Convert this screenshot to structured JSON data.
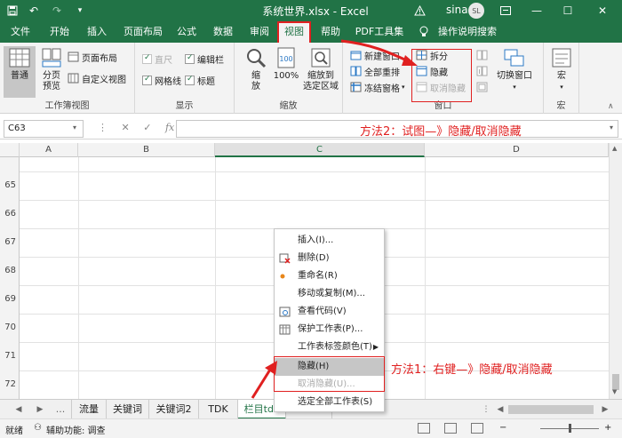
{
  "title_bar": {
    "quick_access": [
      "save-icon",
      "undo-icon",
      "redo-icon",
      "customize-icon"
    ],
    "title": "系统世界.xlsx  -  Excel",
    "user_name": "sina lin",
    "avatar_initials": "SL"
  },
  "menu_tabs": [
    {
      "label": "文件",
      "active": false
    },
    {
      "label": "开始",
      "active": false
    },
    {
      "label": "插入",
      "active": false
    },
    {
      "label": "页面布局",
      "active": false
    },
    {
      "label": "公式",
      "active": false
    },
    {
      "label": "数据",
      "active": false
    },
    {
      "label": "审阅",
      "active": false
    },
    {
      "label": "视图",
      "active": true
    },
    {
      "label": "帮助",
      "active": false
    },
    {
      "label": "PDF工具集",
      "active": false
    },
    {
      "label": "操作说明搜索",
      "active": false
    }
  ],
  "ribbon": {
    "workbook_views": {
      "label": "工作簿视图",
      "normal": "普通",
      "page_break": "分页\n预览",
      "page_layout": "页面布局",
      "custom_views": "自定义视图"
    },
    "show": {
      "label": "显示",
      "ruler": "直尺",
      "formula_bar": "编辑栏",
      "gridlines": "网格线",
      "headings": "标题"
    },
    "zoom": {
      "label": "缩放",
      "zoom": "缩\n放",
      "hundred": "100%",
      "zoom_selection": "缩放到\n选定区域"
    },
    "window": {
      "label": "窗口",
      "new_window": "新建窗口",
      "arrange_all": "全部重排",
      "freeze_panes": "冻结窗格",
      "split": "拆分",
      "hide": "隐藏",
      "unhide": "取消隐藏",
      "switch_windows": "切换窗口"
    },
    "macros": {
      "label": "宏",
      "macros": "宏"
    }
  },
  "formula_bar": {
    "name_box": "C63",
    "fx_label": "fx"
  },
  "annotations": {
    "method2": "方法2：试图—》隐藏/取消隐藏",
    "method1": "方法1：右键—》隐藏/取消隐藏"
  },
  "columns": [
    "A",
    "B",
    "C",
    "D"
  ],
  "rows": [
    "65",
    "66",
    "67",
    "68",
    "69",
    "70",
    "71",
    "72"
  ],
  "sheet_tabs": {
    "nav": [
      "◀",
      "▶",
      "..."
    ],
    "tabs": [
      "流量",
      "关键词",
      "关键词2",
      "TDK",
      "栏目tdk",
      "Sheet"
    ],
    "active_index": 4
  },
  "status_bar": {
    "ready": "就绪",
    "accessibility": "辅助功能: 调查",
    "zoom_percent": 100
  },
  "context_menu": [
    {
      "label": "插入(I)...",
      "icon": "",
      "disabled": false,
      "submenu": false,
      "highlighted": false
    },
    {
      "label": "删除(D)",
      "icon": "delete-sheet-icon",
      "disabled": false,
      "submenu": false,
      "highlighted": false
    },
    {
      "label": "重命名(R)",
      "icon": "rename-icon",
      "disabled": false,
      "submenu": false,
      "highlighted": false
    },
    {
      "label": "移动或复制(M)...",
      "icon": "",
      "disabled": false,
      "submenu": false,
      "highlighted": false
    },
    {
      "label": "查看代码(V)",
      "icon": "view-code-icon",
      "disabled": false,
      "submenu": false,
      "highlighted": false
    },
    {
      "label": "保护工作表(P)...",
      "icon": "protect-sheet-icon",
      "disabled": false,
      "submenu": false,
      "highlighted": false
    },
    {
      "label": "工作表标签颜色(T)",
      "icon": "",
      "disabled": false,
      "submenu": true,
      "highlighted": false
    },
    {
      "label": "隐藏(H)",
      "icon": "",
      "disabled": false,
      "submenu": false,
      "highlighted": true
    },
    {
      "label": "取消隐藏(U)...",
      "icon": "",
      "disabled": true,
      "submenu": false,
      "highlighted": false
    },
    {
      "label": "选定全部工作表(S)",
      "icon": "",
      "disabled": false,
      "submenu": false,
      "highlighted": false
    }
  ],
  "colors": {
    "excel_green": "#217346",
    "annotation_red": "#e02020"
  }
}
